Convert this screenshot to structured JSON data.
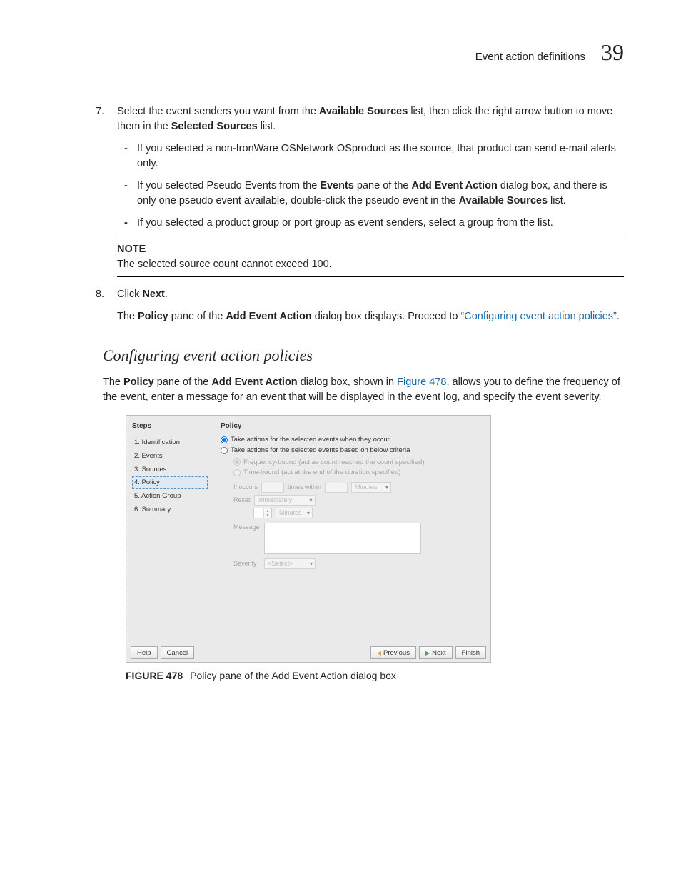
{
  "header": {
    "title": "Event action definitions",
    "page_number": "39"
  },
  "step7": {
    "number": "7.",
    "text_parts": [
      "Select the event senders you want from the ",
      "Available Sources",
      " list, then click the right arrow button to move them in the ",
      "Selected Sources",
      " list."
    ],
    "bullets": [
      {
        "parts": [
          "If you selected a non-IronWare OSNetwork OSproduct as the source, that product can send e-mail alerts only."
        ]
      },
      {
        "parts": [
          "If you selected Pseudo Events from the ",
          "Events",
          " pane of the ",
          "Add Event Action",
          " dialog box, and there is only one pseudo event available, double-click the pseudo event in the ",
          "Available Sources",
          " list."
        ]
      },
      {
        "parts": [
          "If you selected a product group or port group as event senders, select a group from the list."
        ]
      }
    ],
    "note": {
      "title": "NOTE",
      "text": "The selected source count cannot exceed 100."
    }
  },
  "step8": {
    "number": "8.",
    "parts": [
      "Click ",
      "Next",
      "."
    ],
    "follow_parts": [
      "The ",
      "Policy",
      " pane of the ",
      "Add Event Action",
      " dialog box displays. Proceed to ",
      "“Configuring event action policies”",
      "."
    ],
    "follow_link_index": 5
  },
  "subhead": "Configuring event action policies",
  "intro_parts": [
    "The ",
    "Policy",
    " pane of the ",
    "Add Event Action",
    " dialog box, shown in ",
    "Figure 478",
    ", allows you to define the frequency of the event, enter a message for an event that will be displayed in the event log, and specify the event severity."
  ],
  "intro_link_index": 5,
  "dialog": {
    "steps_title": "Steps",
    "steps": [
      "1. Identification",
      "2. Events",
      "3. Sources",
      "4. Policy",
      "5. Action Group",
      "6. Summary"
    ],
    "selected_step_index": 3,
    "policy_title": "Policy",
    "radio1": "Take actions for the selected events when they occur",
    "radio2": "Take actions for the selected events based on below criteria",
    "sub_radio1": "Frequency-bound (act as count reached the count specified)",
    "sub_radio2": "Time-bound (act at the end of the duration specified)",
    "if_occurs_label": "If occurs",
    "times_within": "times within",
    "minutes_dd": "Minutes",
    "reset_label": "Reset",
    "reset_dd": "Immediately",
    "message_label": "Message",
    "severity_label": "Severity",
    "severity_dd": "<Select>",
    "buttons": {
      "help": "Help",
      "cancel": "Cancel",
      "previous": "Previous",
      "next": "Next",
      "finish": "Finish"
    }
  },
  "figure_caption": {
    "label": "FIGURE 478",
    "text": "Policy pane of the Add Event Action dialog box"
  }
}
